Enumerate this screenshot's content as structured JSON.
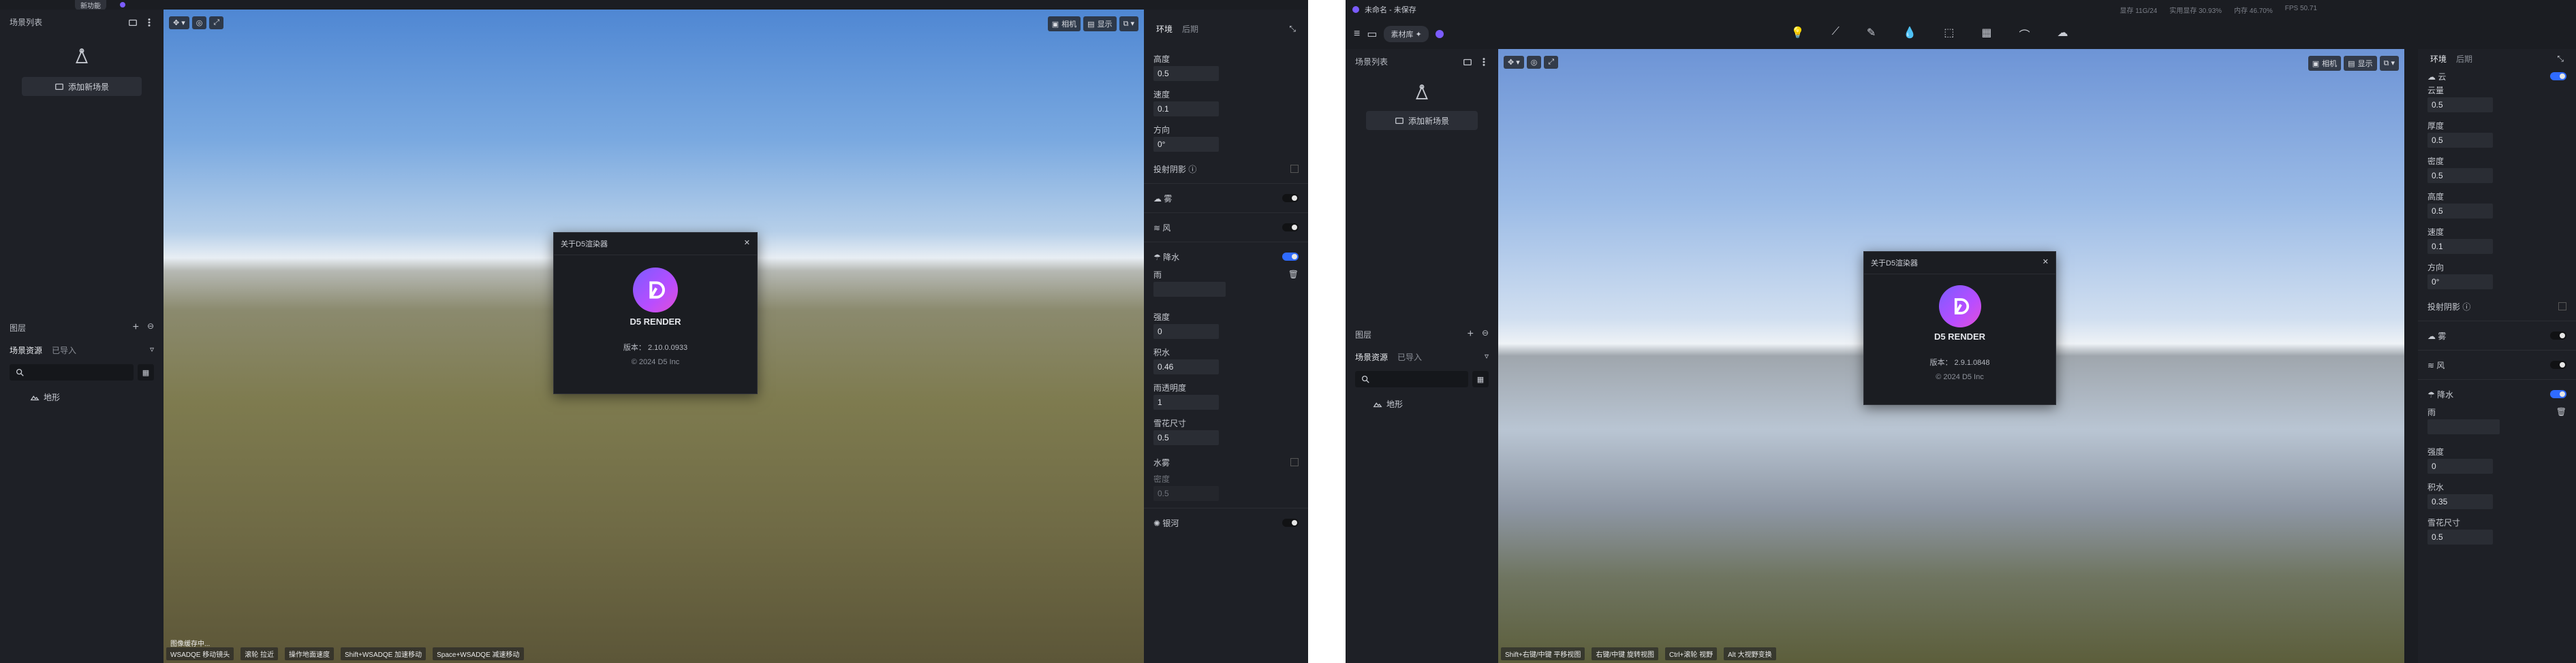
{
  "win1": {
    "top_tab": "新功能",
    "left": {
      "scene_list_title": "场景列表",
      "add_scene": "添加新场景",
      "layers_title": "图层",
      "tab_assets": "场景资源",
      "tab_imported": "已导入",
      "tree_item": "地形"
    },
    "right": {
      "tab_env": "环境",
      "tab_post": "后期",
      "props": [
        {
          "label": "高度",
          "value": "0.5"
        },
        {
          "label": "速度",
          "value": "0.1"
        },
        {
          "label": "方向",
          "value": "0°"
        }
      ],
      "cast_shadow": "投射阴影",
      "cloud": "雾",
      "wind": "风",
      "precip": "降水",
      "rain": "雨",
      "props2": [
        {
          "label": "强度",
          "value": "0"
        },
        {
          "label": "积水",
          "value": "0.46"
        },
        {
          "label": "雨透明度",
          "value": "1"
        },
        {
          "label": "雪花尺寸",
          "value": "0.5"
        }
      ],
      "water_fog": "水雾",
      "density": "密度",
      "density_value": "0.5",
      "galaxy": "银河"
    },
    "viewport": {
      "camera": "相机",
      "display": "显示",
      "hints": [
        "WSADQE 移动镜头",
        "滚轮 拉近",
        "操作地面速度",
        "Shift+WSADQE 加速移动",
        "Space+WSADQE 减速移动"
      ],
      "corner_text": "图像缓存中..."
    },
    "dialog": {
      "title": "关于D5渲染器",
      "brand": "D5 RENDER",
      "version_label": "版本：",
      "version": "2.10.0.0933",
      "copyright": "© 2024 D5 Inc"
    }
  },
  "win2": {
    "title": "未命名 - 未保存",
    "tab_material": "素材库",
    "stats": [
      "显存 11G/24",
      "实用显存 30.93%",
      "内存 46.70%",
      "FPS 50.71"
    ],
    "left": {
      "scene_list_title": "场景列表",
      "add_scene": "添加新场景",
      "layers_title": "图层",
      "tab_assets": "场景资源",
      "tab_imported": "已导入",
      "tree_item": "地形"
    },
    "right": {
      "tab_env": "环境",
      "tab_post": "后期",
      "cloud_title": "云",
      "props": [
        {
          "label": "云量",
          "value": "0.5"
        },
        {
          "label": "厚度",
          "value": "0.5"
        },
        {
          "label": "密度",
          "value": "0.5"
        },
        {
          "label": "高度",
          "value": "0.5"
        },
        {
          "label": "速度",
          "value": "0.1"
        },
        {
          "label": "方向",
          "value": "0°"
        }
      ],
      "cast_shadow": "投射阴影",
      "fog": "雾",
      "wind": "风",
      "precip": "降水",
      "rain": "雨",
      "props2": [
        {
          "label": "强度",
          "value": "0"
        },
        {
          "label": "积水",
          "value": "0.35"
        },
        {
          "label": "雪花尺寸",
          "value": "0.5"
        }
      ]
    },
    "viewport": {
      "camera": "相机",
      "display": "显示",
      "hints": [
        "Shift+右键/中键 平移视图",
        "右键/中键 旋转视图",
        "Ctrl+滚轮 视野",
        "Alt 大视野变换"
      ]
    },
    "dialog": {
      "title": "关于D5渲染器",
      "brand": "D5 RENDER",
      "version_label": "版本：",
      "version": "2.9.1.0848",
      "copyright": "© 2024 D5 Inc"
    }
  }
}
